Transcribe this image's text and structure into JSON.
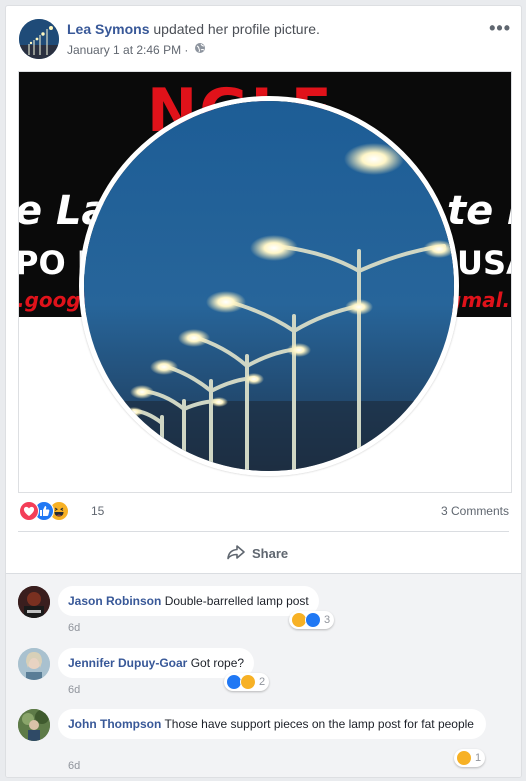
{
  "post": {
    "author": "Lea Symons",
    "action": "updated her profile picture.",
    "timestamp": "January 1 at 2:46 PM",
    "separator": " · "
  },
  "cover": {
    "red_text": "NGLE",
    "line1_left": "e Las",
    "line1_right": "te M",
    "line2_left": "PO Bo",
    "line2_right": "USA",
    "line3_left": ".googl",
    "line3_right": "gmal."
  },
  "reactions": {
    "icons": [
      "love-icon",
      "like-icon",
      "haha-icon"
    ],
    "count": "15"
  },
  "comments_count_label": "3 Comments",
  "share_label": "Share",
  "colors": {
    "like": "#2078f4",
    "love": "#f33e58",
    "haha": "#f7b125",
    "name": "#385898"
  },
  "comments": [
    {
      "name": "Jason Robinson",
      "text": "Double-barrelled lamp post",
      "time": "6d",
      "reaction_count": "3",
      "reaction_icons": [
        "haha-icon",
        "like-icon"
      ]
    },
    {
      "name": "Jennifer Dupuy-Goar",
      "text": "Got rope?",
      "time": "6d",
      "reaction_count": "2",
      "reaction_icons": [
        "like-icon",
        "haha-icon"
      ]
    },
    {
      "name": "John Thompson",
      "text": "Those have support pieces on the lamp post for fat people",
      "time": "6d",
      "reaction_count": "1",
      "reaction_icons": [
        "haha-icon"
      ]
    }
  ]
}
